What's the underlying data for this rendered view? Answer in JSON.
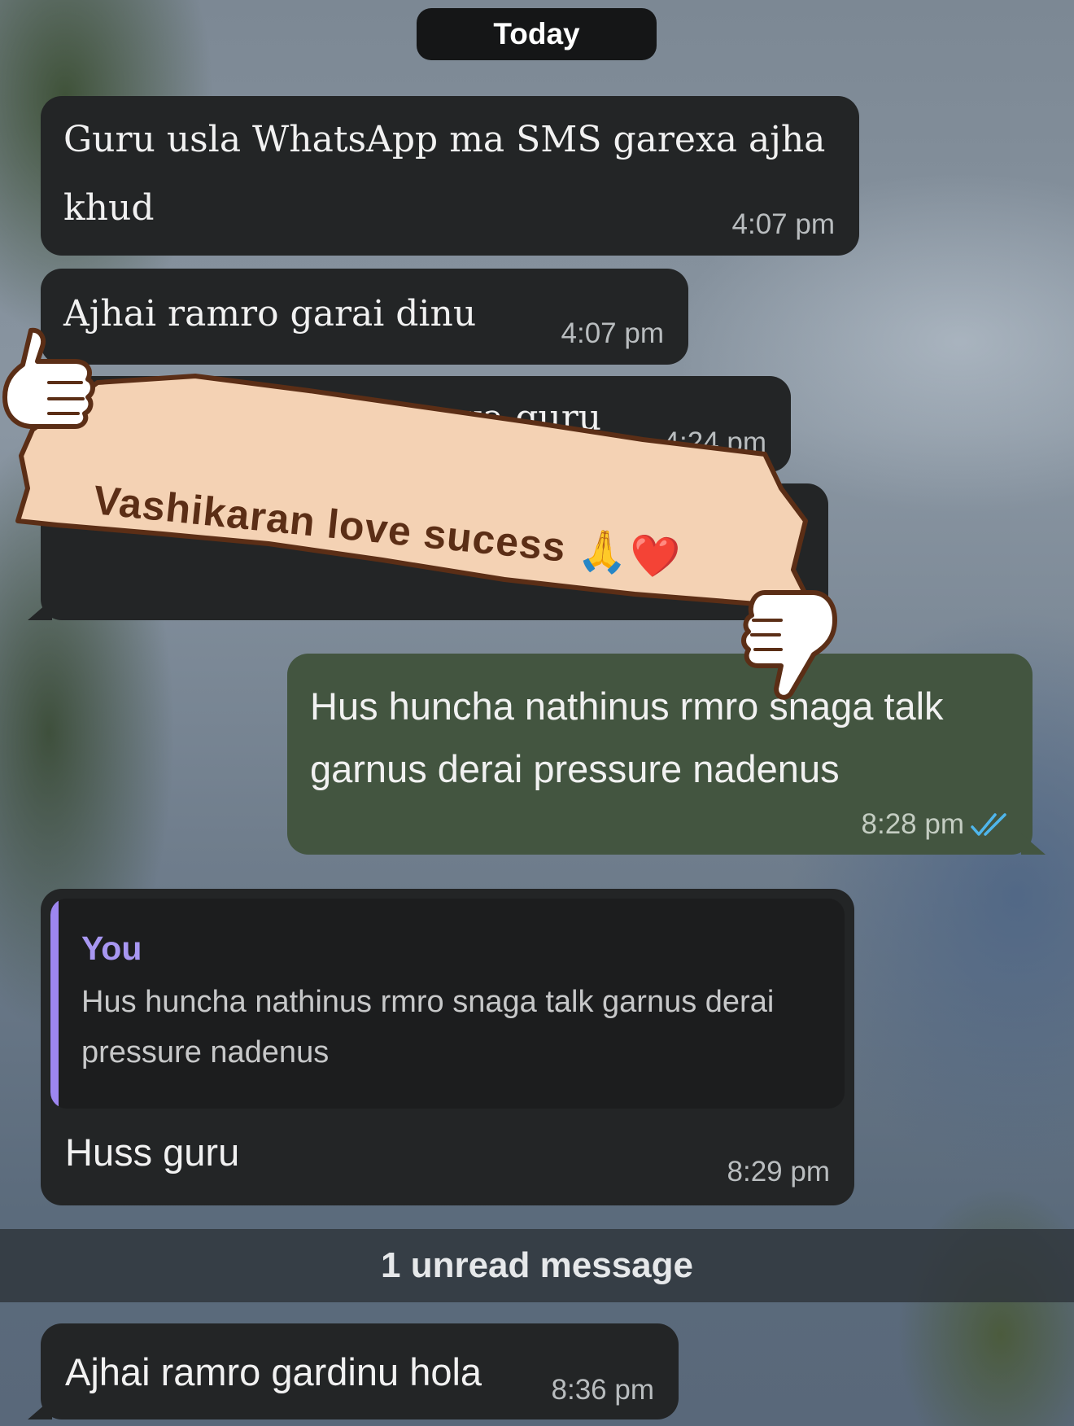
{
  "date_divider": "Today",
  "messages": [
    {
      "text": "Guru usla WhatsApp ma SMS garexa ajha\nkhud",
      "time": "4:07 pm"
    },
    {
      "text": "Ajhai ramro garai dinu",
      "time": "4:07 pm"
    },
    {
      "text": "...la ma xa guru",
      "time": "4:24 pm"
    },
    {
      "text": "Hus huncha nathinus rmro snaga talk\ngarnus derai pressure nadenus",
      "time": "8:28 pm"
    },
    {
      "reply_author": "You",
      "reply_text": "Hus huncha nathinus rmro snaga talk garnus derai pressure nadenus",
      "text": "Huss guru",
      "time": "8:29 pm"
    },
    {
      "text": "Ajhai ramro gardinu hola",
      "time": "8:36 pm"
    }
  ],
  "unread_label": "1 unread message",
  "overlay": {
    "banner_text": "Vashikaran love sucess 🙏❤️",
    "thumbs_up": "👍",
    "thumbs_down": "👎"
  },
  "colors": {
    "incoming_bubble": "#232526",
    "outgoing_bubble": "#435540",
    "reply_accent": "#9d86f0",
    "read_ticks": "#4fb6ec",
    "banner_fill": "#f4d2b4",
    "banner_outline": "#5b2e16"
  },
  "icons": [
    "double-check-icon",
    "thumbs-up-icon",
    "thumbs-down-icon"
  ]
}
